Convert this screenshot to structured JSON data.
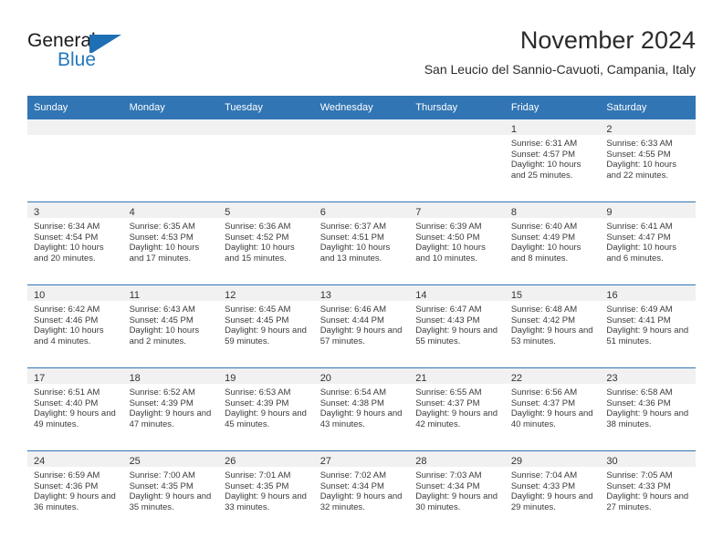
{
  "brand": {
    "word_top": "General",
    "word_bottom": "Blue",
    "logo_color": "#1f6fb5",
    "text_color": "#1a1a1a"
  },
  "header": {
    "title": "November 2024",
    "subtitle": "San Leucio del Sannio-Cavuoti, Campania, Italy"
  },
  "theme": {
    "header_blue": "#3175b4",
    "daynum_band": "#f1f1f1",
    "body_text": "#3a3a3a",
    "page_bg": "#ffffff"
  },
  "calendar": {
    "columns": [
      "Sunday",
      "Monday",
      "Tuesday",
      "Wednesday",
      "Thursday",
      "Friday",
      "Saturday"
    ],
    "labels": {
      "sunrise": "Sunrise:",
      "sunset": "Sunset:",
      "daylight": "Daylight:"
    },
    "weeks": [
      [
        {
          "day": ""
        },
        {
          "day": ""
        },
        {
          "day": ""
        },
        {
          "day": ""
        },
        {
          "day": ""
        },
        {
          "day": "1",
          "sunrise": "6:31 AM",
          "sunset": "4:57 PM",
          "daylight": "10 hours and 25 minutes."
        },
        {
          "day": "2",
          "sunrise": "6:33 AM",
          "sunset": "4:55 PM",
          "daylight": "10 hours and 22 minutes."
        }
      ],
      [
        {
          "day": "3",
          "sunrise": "6:34 AM",
          "sunset": "4:54 PM",
          "daylight": "10 hours and 20 minutes."
        },
        {
          "day": "4",
          "sunrise": "6:35 AM",
          "sunset": "4:53 PM",
          "daylight": "10 hours and 17 minutes."
        },
        {
          "day": "5",
          "sunrise": "6:36 AM",
          "sunset": "4:52 PM",
          "daylight": "10 hours and 15 minutes."
        },
        {
          "day": "6",
          "sunrise": "6:37 AM",
          "sunset": "4:51 PM",
          "daylight": "10 hours and 13 minutes."
        },
        {
          "day": "7",
          "sunrise": "6:39 AM",
          "sunset": "4:50 PM",
          "daylight": "10 hours and 10 minutes."
        },
        {
          "day": "8",
          "sunrise": "6:40 AM",
          "sunset": "4:49 PM",
          "daylight": "10 hours and 8 minutes."
        },
        {
          "day": "9",
          "sunrise": "6:41 AM",
          "sunset": "4:47 PM",
          "daylight": "10 hours and 6 minutes."
        }
      ],
      [
        {
          "day": "10",
          "sunrise": "6:42 AM",
          "sunset": "4:46 PM",
          "daylight": "10 hours and 4 minutes."
        },
        {
          "day": "11",
          "sunrise": "6:43 AM",
          "sunset": "4:45 PM",
          "daylight": "10 hours and 2 minutes."
        },
        {
          "day": "12",
          "sunrise": "6:45 AM",
          "sunset": "4:45 PM",
          "daylight": "9 hours and 59 minutes."
        },
        {
          "day": "13",
          "sunrise": "6:46 AM",
          "sunset": "4:44 PM",
          "daylight": "9 hours and 57 minutes."
        },
        {
          "day": "14",
          "sunrise": "6:47 AM",
          "sunset": "4:43 PM",
          "daylight": "9 hours and 55 minutes."
        },
        {
          "day": "15",
          "sunrise": "6:48 AM",
          "sunset": "4:42 PM",
          "daylight": "9 hours and 53 minutes."
        },
        {
          "day": "16",
          "sunrise": "6:49 AM",
          "sunset": "4:41 PM",
          "daylight": "9 hours and 51 minutes."
        }
      ],
      [
        {
          "day": "17",
          "sunrise": "6:51 AM",
          "sunset": "4:40 PM",
          "daylight": "9 hours and 49 minutes."
        },
        {
          "day": "18",
          "sunrise": "6:52 AM",
          "sunset": "4:39 PM",
          "daylight": "9 hours and 47 minutes."
        },
        {
          "day": "19",
          "sunrise": "6:53 AM",
          "sunset": "4:39 PM",
          "daylight": "9 hours and 45 minutes."
        },
        {
          "day": "20",
          "sunrise": "6:54 AM",
          "sunset": "4:38 PM",
          "daylight": "9 hours and 43 minutes."
        },
        {
          "day": "21",
          "sunrise": "6:55 AM",
          "sunset": "4:37 PM",
          "daylight": "9 hours and 42 minutes."
        },
        {
          "day": "22",
          "sunrise": "6:56 AM",
          "sunset": "4:37 PM",
          "daylight": "9 hours and 40 minutes."
        },
        {
          "day": "23",
          "sunrise": "6:58 AM",
          "sunset": "4:36 PM",
          "daylight": "9 hours and 38 minutes."
        }
      ],
      [
        {
          "day": "24",
          "sunrise": "6:59 AM",
          "sunset": "4:36 PM",
          "daylight": "9 hours and 36 minutes."
        },
        {
          "day": "25",
          "sunrise": "7:00 AM",
          "sunset": "4:35 PM",
          "daylight": "9 hours and 35 minutes."
        },
        {
          "day": "26",
          "sunrise": "7:01 AM",
          "sunset": "4:35 PM",
          "daylight": "9 hours and 33 minutes."
        },
        {
          "day": "27",
          "sunrise": "7:02 AM",
          "sunset": "4:34 PM",
          "daylight": "9 hours and 32 minutes."
        },
        {
          "day": "28",
          "sunrise": "7:03 AM",
          "sunset": "4:34 PM",
          "daylight": "9 hours and 30 minutes."
        },
        {
          "day": "29",
          "sunrise": "7:04 AM",
          "sunset": "4:33 PM",
          "daylight": "9 hours and 29 minutes."
        },
        {
          "day": "30",
          "sunrise": "7:05 AM",
          "sunset": "4:33 PM",
          "daylight": "9 hours and 27 minutes."
        }
      ]
    ]
  }
}
